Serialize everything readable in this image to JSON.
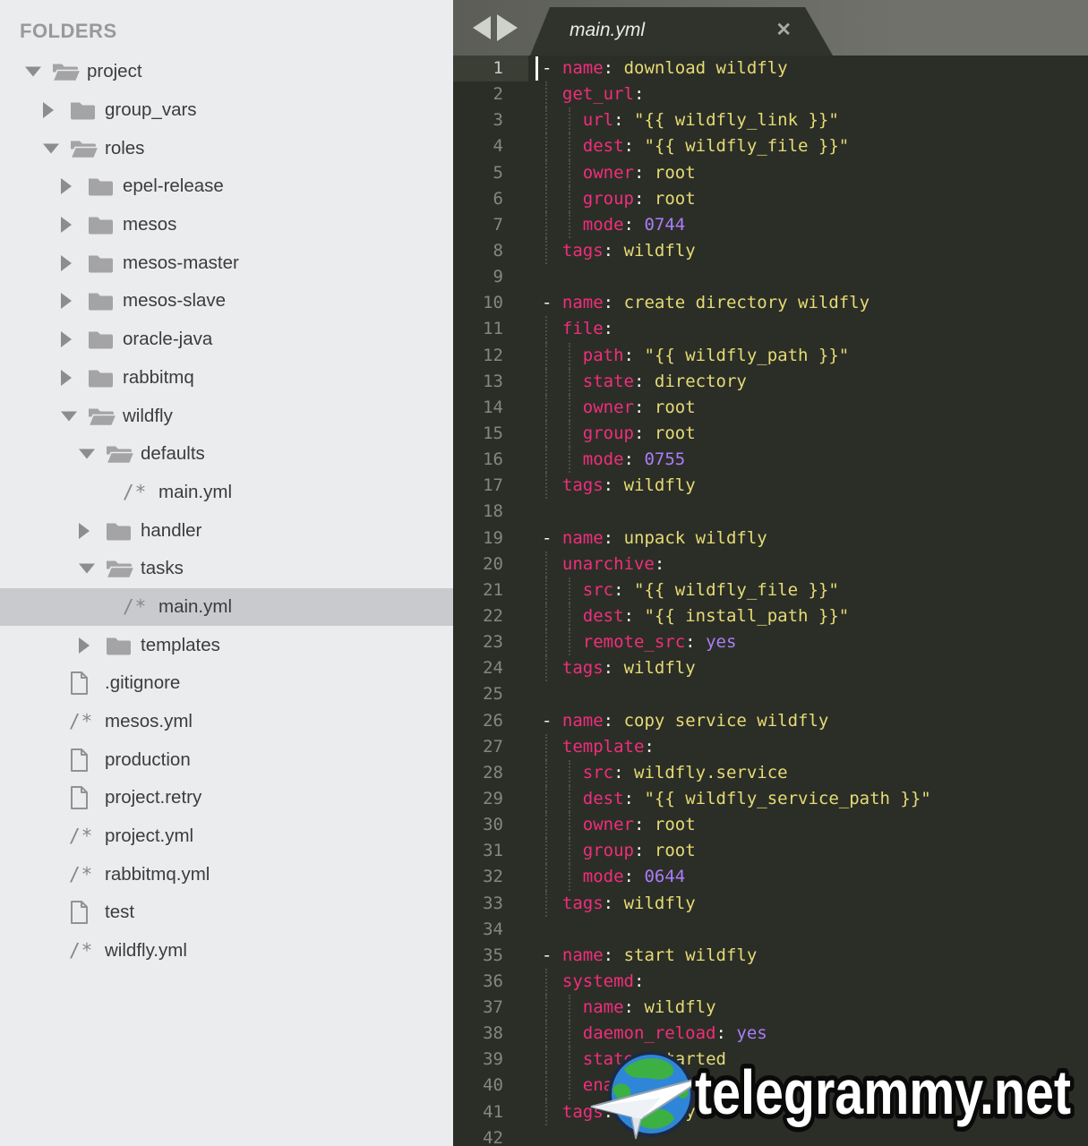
{
  "sidebar": {
    "header": "FOLDERS",
    "items": [
      {
        "label": "project",
        "type": "folder-open",
        "level": 0,
        "expanded": true,
        "selected": false
      },
      {
        "label": "group_vars",
        "type": "folder-closed",
        "level": 1,
        "expanded": false,
        "selected": false
      },
      {
        "label": "roles",
        "type": "folder-open",
        "level": 1,
        "expanded": true,
        "selected": false
      },
      {
        "label": "epel-release",
        "type": "folder-closed",
        "level": 2,
        "expanded": false,
        "selected": false
      },
      {
        "label": "mesos",
        "type": "folder-closed",
        "level": 2,
        "expanded": false,
        "selected": false
      },
      {
        "label": "mesos-master",
        "type": "folder-closed",
        "level": 2,
        "expanded": false,
        "selected": false
      },
      {
        "label": "mesos-slave",
        "type": "folder-closed",
        "level": 2,
        "expanded": false,
        "selected": false
      },
      {
        "label": "oracle-java",
        "type": "folder-closed",
        "level": 2,
        "expanded": false,
        "selected": false
      },
      {
        "label": "rabbitmq",
        "type": "folder-closed",
        "level": 2,
        "expanded": false,
        "selected": false
      },
      {
        "label": "wildfly",
        "type": "folder-open",
        "level": 2,
        "expanded": true,
        "selected": false
      },
      {
        "label": "defaults",
        "type": "folder-open",
        "level": 3,
        "expanded": true,
        "selected": false
      },
      {
        "label": "main.yml",
        "type": "yml",
        "level": 4,
        "expanded": false,
        "selected": false
      },
      {
        "label": "handler",
        "type": "folder-closed",
        "level": 3,
        "expanded": false,
        "selected": false
      },
      {
        "label": "tasks",
        "type": "folder-open",
        "level": 3,
        "expanded": true,
        "selected": false
      },
      {
        "label": "main.yml",
        "type": "yml",
        "level": 4,
        "expanded": false,
        "selected": true
      },
      {
        "label": "templates",
        "type": "folder-closed",
        "level": 3,
        "expanded": false,
        "selected": false
      },
      {
        "label": ".gitignore",
        "type": "file",
        "level": 1,
        "expanded": false,
        "selected": false
      },
      {
        "label": "mesos.yml",
        "type": "yml",
        "level": 1,
        "expanded": false,
        "selected": false
      },
      {
        "label": "production",
        "type": "file",
        "level": 1,
        "expanded": false,
        "selected": false
      },
      {
        "label": "project.retry",
        "type": "file",
        "level": 1,
        "expanded": false,
        "selected": false
      },
      {
        "label": "project.yml",
        "type": "yml",
        "level": 1,
        "expanded": false,
        "selected": false
      },
      {
        "label": "rabbitmq.yml",
        "type": "yml",
        "level": 1,
        "expanded": false,
        "selected": false
      },
      {
        "label": "test",
        "type": "file",
        "level": 1,
        "expanded": false,
        "selected": false
      },
      {
        "label": "wildfly.yml",
        "type": "yml",
        "level": 1,
        "expanded": false,
        "selected": false
      }
    ]
  },
  "editor": {
    "tab_title": "main.yml",
    "tab_close_glyph": "✕",
    "cursor_line": 1,
    "lines": [
      "- name: download wildfly",
      "  get_url:",
      "    url: \"{{ wildfly_link }}\"",
      "    dest: \"{{ wildfly_file }}\"",
      "    owner: root",
      "    group: root",
      "    mode: 0744",
      "  tags: wildfly",
      "",
      "- name: create directory wildfly",
      "  file:",
      "    path: \"{{ wildfly_path }}\"",
      "    state: directory",
      "    owner: root",
      "    group: root",
      "    mode: 0755",
      "  tags: wildfly",
      "",
      "- name: unpack wildfly",
      "  unarchive:",
      "    src: \"{{ wildfly_file }}\"",
      "    dest: \"{{ install_path }}\"",
      "    remote_src: yes",
      "  tags: wildfly",
      "",
      "- name: copy service wildfly",
      "  template:",
      "    src: wildfly.service",
      "    dest: \"{{ wildfly_service_path }}\"",
      "    owner: root",
      "    group: root",
      "    mode: 0644",
      "  tags: wildfly",
      "",
      "- name: start wildfly",
      "  systemd:",
      "    name: wildfly",
      "    daemon_reload: yes",
      "    state: started",
      "    enabled: yes",
      "  tags: wildfly",
      ""
    ]
  },
  "watermark": {
    "text": "telegrammy.net"
  },
  "colors": {
    "key": "#f12d7c",
    "string": "#e6db74",
    "constant": "#ab7dfa",
    "punctuation": "#f4f4ef",
    "editor_bg": "#2b2e27",
    "tab_fill": "#30332c",
    "sidebar_bg": "#ebeced",
    "selected_row": "#c9cacd",
    "gutter_highlight": "#3a3e35"
  }
}
